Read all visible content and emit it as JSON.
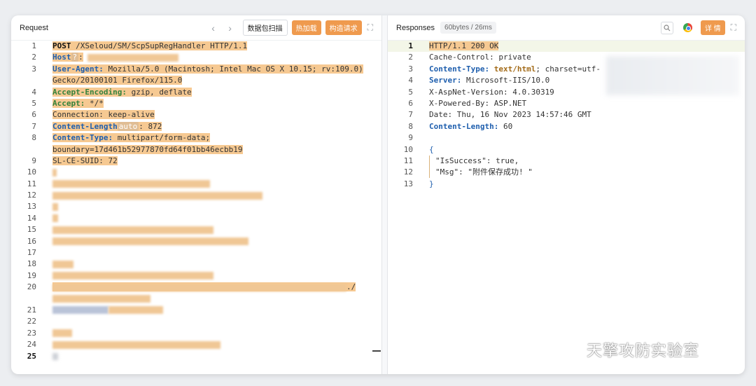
{
  "request": {
    "title": "Request",
    "buttons": {
      "scan": "数据包扫描",
      "hot_load": "热加载",
      "build_request": "构造请求"
    },
    "lines": [
      {
        "n": "1",
        "parts": [
          "POST",
          " /XSeloud/SM/ScpSupRegHandler HTTP/1.1"
        ]
      },
      {
        "n": "2",
        "parts": [
          "Host",
          "?",
          ":"
        ]
      },
      {
        "n": "3",
        "parts": [
          "User-Agent:",
          " Mozilla/5.0 (Macintosh; Intel Mac OS X 10.15; rv:109.0)"
        ]
      },
      {
        "n": "",
        "parts": [
          "Gecko/20100101 Firefox/115.0"
        ]
      },
      {
        "n": "4",
        "parts": [
          "Accept-Encoding:",
          " gzip, deflate"
        ]
      },
      {
        "n": "5",
        "parts": [
          "Accept:",
          " */*"
        ]
      },
      {
        "n": "6",
        "parts": [
          "Connection: keep-alive"
        ]
      },
      {
        "n": "7",
        "parts": [
          "Content-Length",
          "auto",
          ": 872"
        ]
      },
      {
        "n": "8",
        "parts": [
          "Content-Type:",
          " multipart/form-data;"
        ]
      },
      {
        "n": "",
        "parts": [
          "boundary=17d461b52977870fd64f01bb46ecbb19"
        ]
      },
      {
        "n": "9",
        "parts": [
          "SL-CE-SUID: 72"
        ]
      },
      {
        "n": "10"
      },
      {
        "n": "11"
      },
      {
        "n": "12"
      },
      {
        "n": "13"
      },
      {
        "n": "14"
      },
      {
        "n": "15"
      },
      {
        "n": "16"
      },
      {
        "n": "17"
      },
      {
        "n": "18"
      },
      {
        "n": "19"
      },
      {
        "n": "20",
        "parts": [
          "./"
        ]
      },
      {
        "n": ""
      },
      {
        "n": "21"
      },
      {
        "n": "22"
      },
      {
        "n": "23"
      },
      {
        "n": "24"
      },
      {
        "n": "25"
      }
    ]
  },
  "response": {
    "title": "Responses",
    "size_badge": "60bytes / 26ms",
    "detail_button": "详 情",
    "lines": [
      {
        "n": "1",
        "text": "HTTP/1.1 200 OK"
      },
      {
        "n": "2",
        "text": "Cache-Control: private"
      },
      {
        "n": "3",
        "key": "Content-Type:",
        "val": " text/html",
        "rest": "; charset=utf-"
      },
      {
        "n": "4",
        "key": "Server:",
        "rest": " Microsoft-IIS/10.0"
      },
      {
        "n": "5",
        "text": "X-AspNet-Version: 4.0.30319"
      },
      {
        "n": "6",
        "text": "X-Powered-By: ASP.NET"
      },
      {
        "n": "7",
        "text": "Date: Thu, 16 Nov 2023 14:57:46 GMT"
      },
      {
        "n": "8",
        "key": "Content-Length:",
        "rest": " 60"
      },
      {
        "n": "9",
        "text": ""
      },
      {
        "n": "10",
        "text": "{"
      },
      {
        "n": "11",
        "text": "\"IsSuccess\": true,"
      },
      {
        "n": "12",
        "text": "\"Msg\": \"附件保存成功! \""
      },
      {
        "n": "13",
        "text": "}"
      }
    ]
  },
  "watermark": {
    "text": "天擎攻防实验室"
  },
  "colors": {
    "accent_orange": "#ef9a4e",
    "highlight": "#f6c992",
    "keyword_blue": "#1f5fae"
  },
  "icons": [
    "chevron-left-icon",
    "chevron-right-icon",
    "expand-icon",
    "search-icon",
    "chrome-icon",
    "wechat-icon"
  ]
}
